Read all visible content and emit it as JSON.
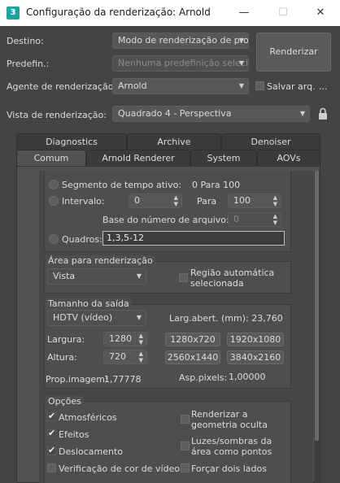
{
  "window": {
    "title": "Configuração da renderização: Arnold",
    "app_icon": "3",
    "minimize": "—",
    "maximize": "☐",
    "close": "✕"
  },
  "top": {
    "destino_label": "Destino:",
    "destino_value": "Modo de renderização de proc",
    "predefin_label": "Predefin.:",
    "predefin_value": "Nenhuma predefinição selecion",
    "render_button": "Renderizar",
    "agente_label": "Agente de renderização:",
    "agente_value": "Arnold",
    "salvar_label": "Salvar arq.",
    "ellipsis": "...",
    "vista_label": "Vista de renderização:",
    "vista_value": "Quadrado 4 - Perspectiva"
  },
  "tabs_row1": [
    "Diagnostics",
    "Archive",
    "Denoiser"
  ],
  "tabs_row2": [
    "Comum",
    "Arnold Renderer",
    "System",
    "AOVs"
  ],
  "time": {
    "segmento_label": "Segmento de tempo ativo:",
    "segmento_value": "0 Para 100",
    "intervalo_label": "Intervalo:",
    "intervalo_from": "0",
    "para_label": "Para",
    "intervalo_to": "100",
    "base_label": "Base do número de arquivo:",
    "base_value": "0",
    "quadros_label": "Quadros:",
    "quadros_value": "1,3,5-12"
  },
  "area": {
    "title": "Área para renderização",
    "value": "Vista",
    "auto_region": "Região automática selecionada"
  },
  "output": {
    "title": "Tamanho da saída",
    "preset": "HDTV (vídeo)",
    "aperture": "Larg.abert. (mm): 23,760",
    "largura_label": "Largura:",
    "largura_value": "1280",
    "altura_label": "Altura:",
    "altura_value": "720",
    "presets": [
      "1280x720",
      "1920x1080",
      "2560x1440",
      "3840x2160"
    ],
    "prop_label": "Prop.imagem:",
    "prop_value": "1,77778",
    "asp_label": "Asp.pixels:",
    "asp_value": "1,00000"
  },
  "options": {
    "title": "Opções",
    "left": [
      {
        "label": "Atmosféricos",
        "checked": true
      },
      {
        "label": "Efeitos",
        "checked": true
      },
      {
        "label": "Deslocamento",
        "checked": true
      },
      {
        "label": "Verificação de cor de vídeo",
        "checked": false
      }
    ],
    "right": [
      {
        "label": "Renderizar a geometria oculta",
        "checked": false
      },
      {
        "label": "Luzes/sombras da área como pontos",
        "checked": false
      },
      {
        "label": "Forçar dois lados",
        "checked": false
      }
    ]
  }
}
